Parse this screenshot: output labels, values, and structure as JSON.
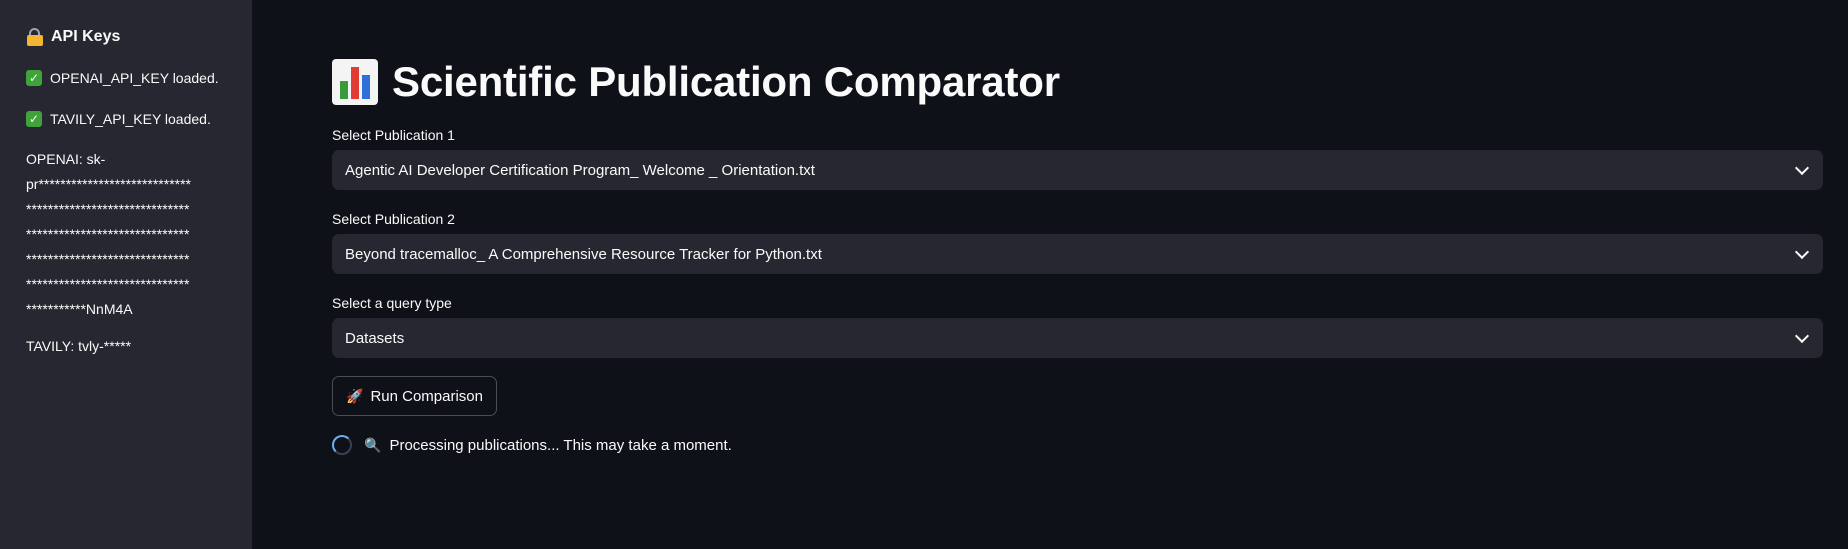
{
  "sidebar": {
    "heading": "API Keys",
    "heading_icon": "lock-icon",
    "status": [
      {
        "icon": "check-icon",
        "text": "OPENAI_API_KEY loaded."
      },
      {
        "icon": "check-icon",
        "text": "TAVILY_API_KEY loaded."
      }
    ],
    "openai_key_lines": [
      "OPENAI: sk-",
      "pr****************************",
      "******************************",
      "******************************",
      "******************************",
      "******************************",
      "***********NnM4A"
    ],
    "tavily_key": "TAVILY: tvly-*****"
  },
  "main": {
    "title": "Scientific Publication Comparator",
    "title_icon": "bar-chart-icon",
    "fields": [
      {
        "label": "Select Publication 1",
        "value": "Agentic AI Developer Certification Program_ Welcome _ Orientation.txt"
      },
      {
        "label": "Select Publication 2",
        "value": "Beyond tracemalloc_ A Comprehensive Resource Tracker for Python.txt"
      },
      {
        "label": "Select a query type",
        "value": "Datasets"
      }
    ],
    "run_button": {
      "icon": "rocket-icon",
      "label": "Run Comparison"
    },
    "processing": {
      "icon": "magnifier-icon",
      "text": "Processing publications... This may take a moment."
    }
  },
  "colors": {
    "background": "#0e1117",
    "sidebar": "#262730",
    "input": "#262730",
    "text": "#fafafa",
    "spinner_accent": "#6fb0f2"
  }
}
